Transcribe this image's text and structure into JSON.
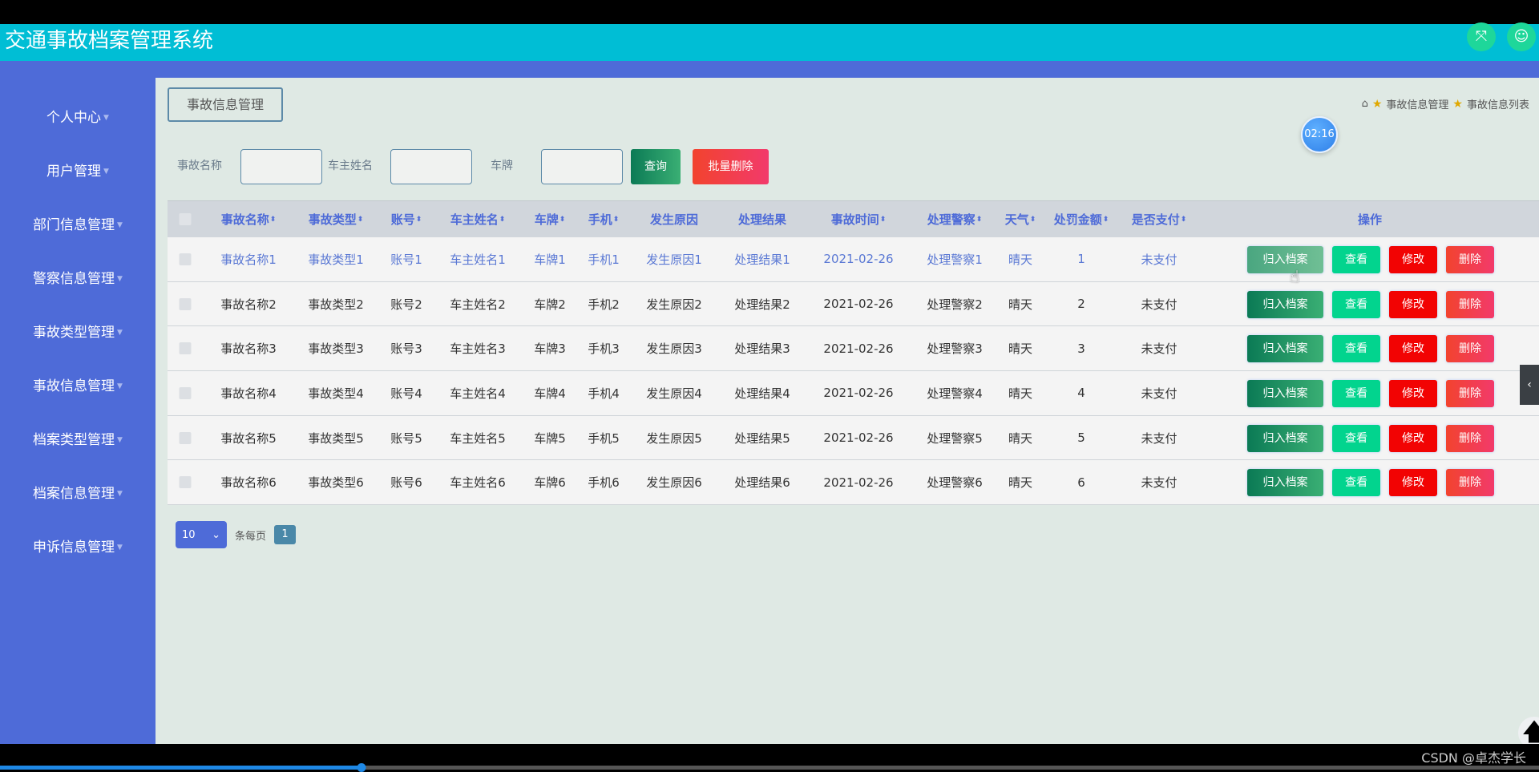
{
  "app": {
    "title": "交通事故档案管理系统",
    "icons": [
      "fullscreen-icon",
      "user-icon"
    ]
  },
  "sidebar": {
    "items": [
      {
        "label": "个人中心"
      },
      {
        "label": "用户管理"
      },
      {
        "label": "部门信息管理"
      },
      {
        "label": "警察信息管理"
      },
      {
        "label": "事故类型管理"
      },
      {
        "label": "事故信息管理"
      },
      {
        "label": "档案类型管理"
      },
      {
        "label": "档案信息管理"
      },
      {
        "label": "申诉信息管理"
      }
    ]
  },
  "page": {
    "title": "事故信息管理",
    "breadcrumb": [
      "事故信息管理",
      "事故信息列表"
    ],
    "timer": "02:16"
  },
  "search": {
    "fields": [
      {
        "label": "事故名称",
        "value": ""
      },
      {
        "label": "车主姓名",
        "value": ""
      },
      {
        "label": "车牌",
        "value": ""
      }
    ],
    "query_label": "查询",
    "batch_delete_label": "批量删除"
  },
  "table": {
    "columns": [
      {
        "label": "事故名称",
        "sortable": true
      },
      {
        "label": "事故类型",
        "sortable": true
      },
      {
        "label": "账号",
        "sortable": true
      },
      {
        "label": "车主姓名",
        "sortable": true
      },
      {
        "label": "车牌",
        "sortable": true
      },
      {
        "label": "手机",
        "sortable": true
      },
      {
        "label": "发生原因",
        "sortable": false
      },
      {
        "label": "处理结果",
        "sortable": false
      },
      {
        "label": "事故时间",
        "sortable": true
      },
      {
        "label": "处理警察",
        "sortable": true
      },
      {
        "label": "天气",
        "sortable": true
      },
      {
        "label": "处罚金额",
        "sortable": true
      },
      {
        "label": "是否支付",
        "sortable": true
      }
    ],
    "actions_label": "操作",
    "action_buttons": [
      "归入档案",
      "查看",
      "修改",
      "删除"
    ],
    "rows": [
      [
        "事故名称1",
        "事故类型1",
        "账号1",
        "车主姓名1",
        "车牌1",
        "手机1",
        "发生原因1",
        "处理结果1",
        "2021-02-26",
        "处理警察1",
        "晴天",
        "1",
        "未支付"
      ],
      [
        "事故名称2",
        "事故类型2",
        "账号2",
        "车主姓名2",
        "车牌2",
        "手机2",
        "发生原因2",
        "处理结果2",
        "2021-02-26",
        "处理警察2",
        "晴天",
        "2",
        "未支付"
      ],
      [
        "事故名称3",
        "事故类型3",
        "账号3",
        "车主姓名3",
        "车牌3",
        "手机3",
        "发生原因3",
        "处理结果3",
        "2021-02-26",
        "处理警察3",
        "晴天",
        "3",
        "未支付"
      ],
      [
        "事故名称4",
        "事故类型4",
        "账号4",
        "车主姓名4",
        "车牌4",
        "手机4",
        "发生原因4",
        "处理结果4",
        "2021-02-26",
        "处理警察4",
        "晴天",
        "4",
        "未支付"
      ],
      [
        "事故名称5",
        "事故类型5",
        "账号5",
        "车主姓名5",
        "车牌5",
        "手机5",
        "发生原因5",
        "处理结果5",
        "2021-02-26",
        "处理警察5",
        "晴天",
        "5",
        "未支付"
      ],
      [
        "事故名称6",
        "事故类型6",
        "账号6",
        "车主姓名6",
        "车牌6",
        "手机6",
        "发生原因6",
        "处理结果6",
        "2021-02-26",
        "处理警察6",
        "晴天",
        "6",
        "未支付"
      ]
    ]
  },
  "pagination": {
    "page_size": "10",
    "per_page_label": "条每页",
    "current_page": "1"
  },
  "video": {
    "progress": 0.235,
    "watermark": "CSDN @卓杰学长"
  }
}
